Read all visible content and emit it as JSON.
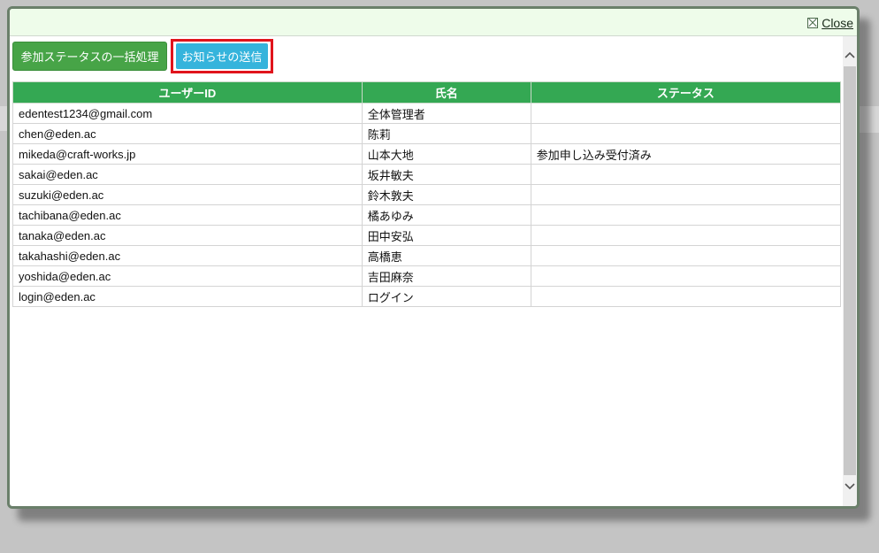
{
  "modal": {
    "close_label": "Close",
    "icons": {
      "close": "close-box-icon",
      "up": "chevron-up-icon",
      "down": "chevron-down-icon"
    }
  },
  "toolbar": {
    "bulk_status_label": "参加ステータスの一括処理",
    "send_notice_label": "お知らせの送信"
  },
  "table": {
    "headers": [
      "ユーザーID",
      "氏名",
      "ステータス"
    ],
    "rows": [
      [
        "edentest1234@gmail.com",
        "全体管理者",
        ""
      ],
      [
        "chen@eden.ac",
        "陈莉",
        ""
      ],
      [
        "mikeda@craft-works.jp",
        "山本大地",
        "参加申し込み受付済み"
      ],
      [
        "sakai@eden.ac",
        "坂井敏夫",
        ""
      ],
      [
        "suzuki@eden.ac",
        "鈴木敦夫",
        ""
      ],
      [
        "tachibana@eden.ac",
        "橘あゆみ",
        ""
      ],
      [
        "tanaka@eden.ac",
        "田中安弘",
        ""
      ],
      [
        "takahashi@eden.ac",
        "高橋恵",
        ""
      ],
      [
        "yoshida@eden.ac",
        "吉田麻奈",
        ""
      ],
      [
        "login@eden.ac",
        "ログイン",
        ""
      ]
    ]
  },
  "colors": {
    "header_green": "#34a853",
    "button_green": "#47a447",
    "button_cyan": "#35b4dc",
    "highlight_red": "#e0141c"
  }
}
